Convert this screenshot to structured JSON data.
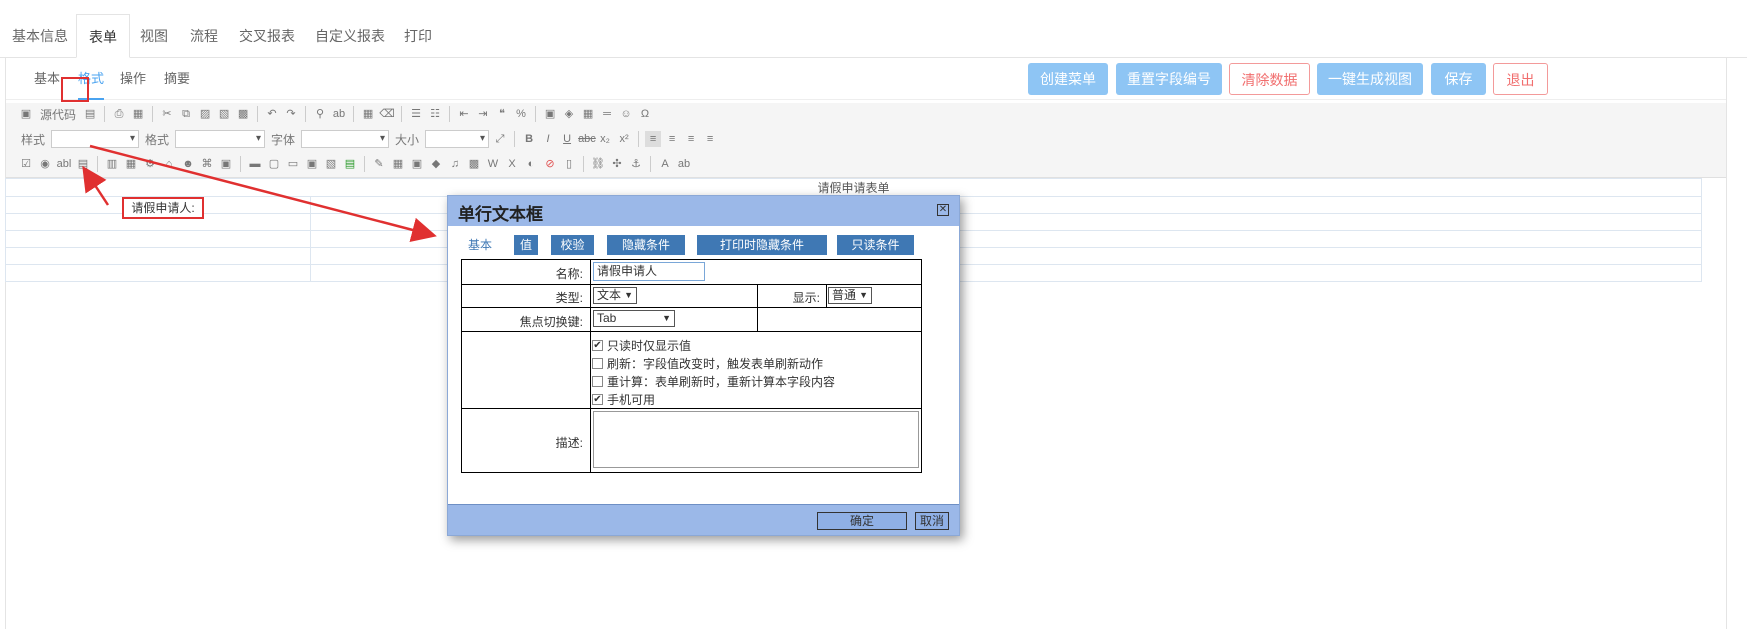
{
  "top_tabs": [
    "基本信息",
    "表单",
    "视图",
    "流程",
    "交叉报表",
    "自定义报表",
    "打印"
  ],
  "sub_tabs": [
    "基本",
    "格式",
    "操作",
    "摘要"
  ],
  "actions": {
    "create_menu": "创建菜单",
    "reset_field_no": "重置字段编号",
    "clear_data": "清除数据",
    "gen_view": "一键生成视图",
    "save": "保存",
    "exit": "退出"
  },
  "toolbar": {
    "source": "源代码",
    "style": "样式",
    "format": "格式",
    "font": "字体",
    "size": "大小"
  },
  "form": {
    "title": "请假申请表单",
    "applicant_label": "请假申请人:"
  },
  "dialog": {
    "title": "单行文本框",
    "tabs": [
      "基本",
      "值",
      "校验",
      "隐藏条件",
      "打印时隐藏条件",
      "只读条件"
    ],
    "name_label": "名称:",
    "name_value": "请假申请人",
    "type_label": "类型:",
    "type_value": "文本",
    "display_label": "显示:",
    "display_value": "普通",
    "focus_label": "焦点切换键:",
    "focus_value": "Tab",
    "options": [
      {
        "label": "只读时仅显示值",
        "checked": "✔"
      },
      {
        "label": "刷新：字段值改变时，触发表单刷新动作",
        "checked": ""
      },
      {
        "label": "重计算：表单刷新时，重新计算本字段内容",
        "checked": ""
      },
      {
        "label": "手机可用",
        "checked": "✔"
      }
    ],
    "desc_label": "描述:",
    "ok": "确定",
    "cancel": "取消"
  },
  "colors": {
    "accent": "#4aa3f0",
    "annotation": "#e03030",
    "dialog_header": "#9bb8e8",
    "tab_blue": "#3f78b4"
  }
}
